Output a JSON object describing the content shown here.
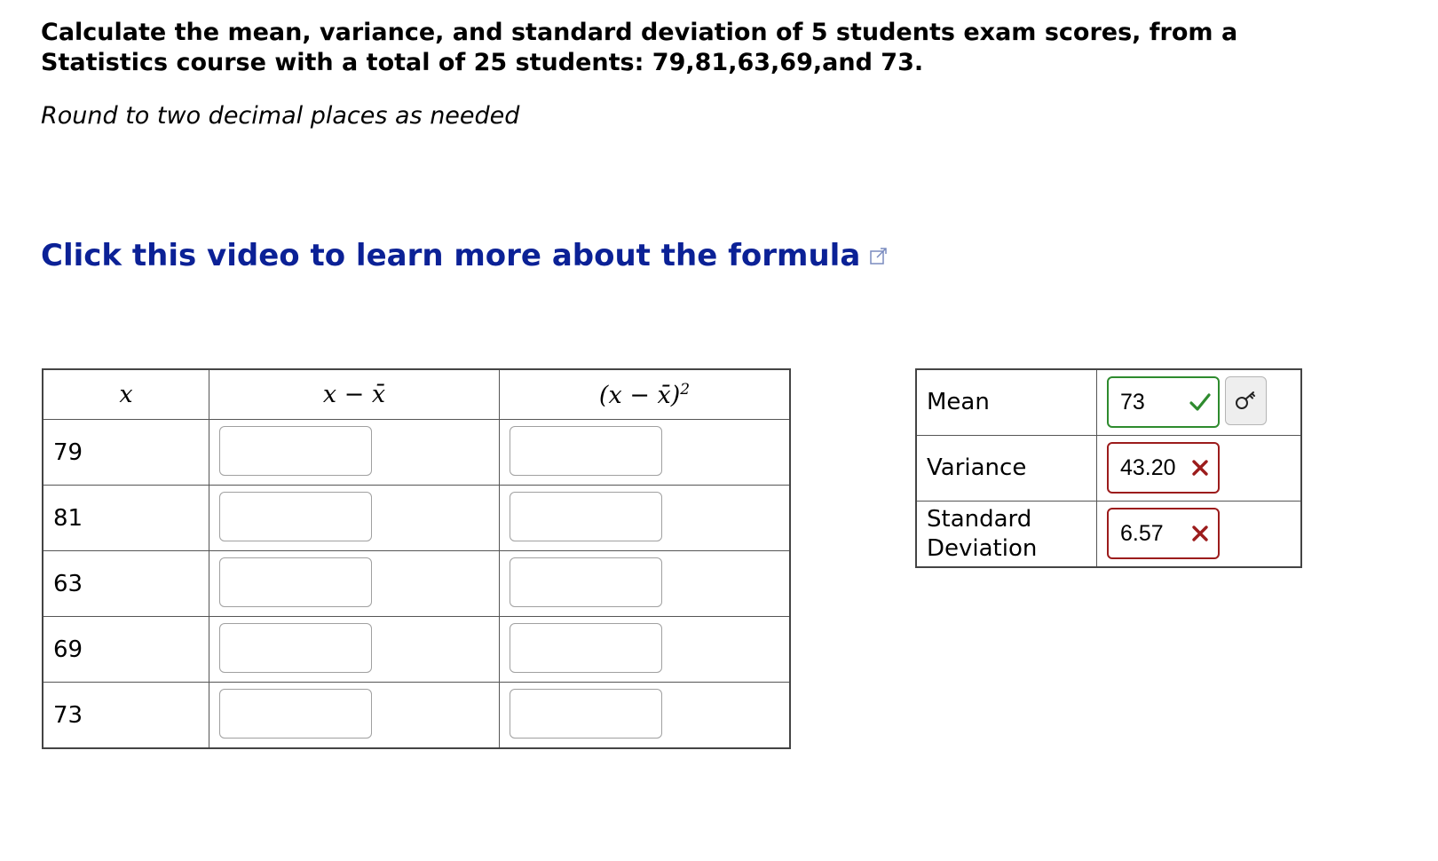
{
  "question": {
    "text": "Calculate the mean, variance, and standard deviation of 5 students exam scores, from a Statistics course with a total of 25 students: 79,81,63,69,and 73.",
    "instruction": "Round to two decimal places as needed"
  },
  "video_link": {
    "label": "Click this video to learn more about the formula",
    "icon": "external-link-icon",
    "color": "#0b2196"
  },
  "calc_table": {
    "headers": [
      "x",
      "x − x̄",
      "(x − x̄)",
      "2"
    ],
    "rows": [
      {
        "x": "79",
        "deviation": "",
        "squared": ""
      },
      {
        "x": "81",
        "deviation": "",
        "squared": ""
      },
      {
        "x": "63",
        "deviation": "",
        "squared": ""
      },
      {
        "x": "69",
        "deviation": "",
        "squared": ""
      },
      {
        "x": "73",
        "deviation": "",
        "squared": ""
      }
    ]
  },
  "results": {
    "mean": {
      "label": "Mean",
      "value": "73",
      "status": "correct",
      "status_color": "#2e8b2e"
    },
    "variance": {
      "label": "Variance",
      "value": "43.20",
      "status": "incorrect",
      "status_color": "#9c1c1c"
    },
    "std_dev": {
      "label_line1": "Standard",
      "label_line2": "Deviation",
      "value": "6.57",
      "status": "incorrect",
      "status_color": "#9c1c1c"
    },
    "key_button_icon": "key-icon"
  }
}
